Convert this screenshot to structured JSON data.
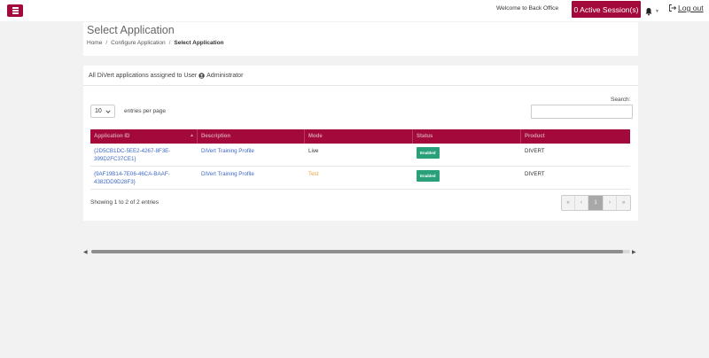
{
  "topbar": {
    "welcome_text": "Welcome to Back Office",
    "sessions_label": "0 Active Session(s)",
    "logout_label": "Log out"
  },
  "header": {
    "title": "Select Application",
    "breadcrumb": [
      {
        "label": "Home"
      },
      {
        "label": "Configure Application"
      },
      {
        "label": "Select Application"
      }
    ],
    "separator": "/"
  },
  "card": {
    "title_prefix": "All DiVert applications assigned to User",
    "user_name": "Administrator"
  },
  "controls": {
    "page_length_value": "10",
    "page_length_label": "entries per page",
    "search_label": "Search:",
    "search_value": ""
  },
  "table": {
    "columns": [
      "Application ID",
      "Description",
      "Mode",
      "Status",
      "Product"
    ],
    "rows": [
      {
        "app_id": "{2D5CB1DC-5EE2-4267-8F3E-399D2FC37CE1}",
        "description": "DiVert Training Profile",
        "mode": "Live",
        "status": "Enabled",
        "product": "DIVERT"
      },
      {
        "app_id": "{9AF19B14-7E06-46CA-BAAF-4382DD9D28F3}",
        "description": "DiVert Training Profile",
        "mode": "Test",
        "status": "Enabled",
        "product": "DIVERT"
      }
    ]
  },
  "footer": {
    "info_text": "Showing 1 to 2 of 2 entries",
    "pager": {
      "first": "«",
      "prev": "‹",
      "current": "1",
      "next": "›",
      "last": "»"
    }
  },
  "colors": {
    "brand": "#a4093b",
    "link": "#3d68c7",
    "test_mode": "#e8a13a",
    "enabled_badge": "#2aa07a"
  },
  "icons": {
    "menu": "hamburger-icon",
    "bell": "bell-icon",
    "logout": "logout-icon",
    "user": "user-circle-icon"
  }
}
